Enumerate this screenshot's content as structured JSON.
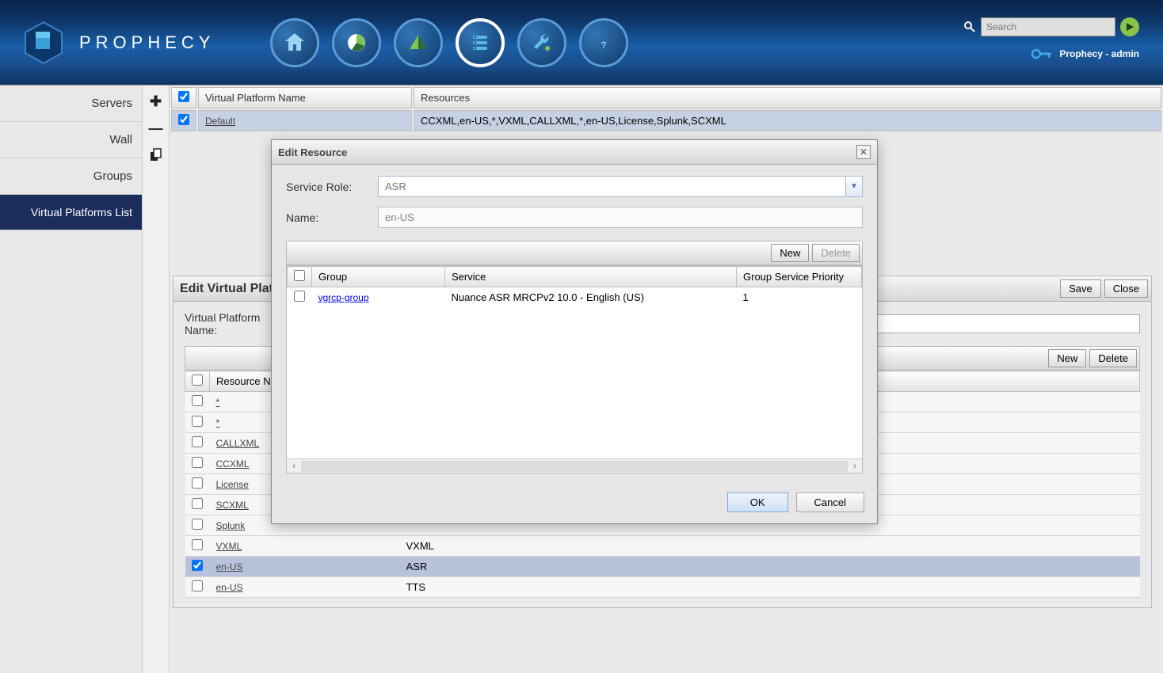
{
  "header": {
    "brand": "PROPHECY",
    "search_placeholder": "Search",
    "user_label": "Prophecy - admin"
  },
  "sidebar": {
    "items": [
      "Servers",
      "Wall",
      "Groups",
      "Virtual Platforms List"
    ]
  },
  "top_table": {
    "headers": [
      "Virtual Platform Name",
      "Resources"
    ],
    "row": {
      "name": "Default",
      "resources": "CCXML,en-US,*,VXML,CALLXML,*,en-US,License,Splunk,SCXML"
    }
  },
  "evp": {
    "title": "Edit Virtual Platform",
    "save": "Save",
    "close": "Close",
    "vp_name_label": "Virtual Platform Name:",
    "toolbar_new": "New",
    "toolbar_delete": "Delete",
    "col_resource": "Resource Name",
    "rows": [
      {
        "name": "*",
        "role": ""
      },
      {
        "name": "*",
        "role": ""
      },
      {
        "name": "CALLXML",
        "role": ""
      },
      {
        "name": "CCXML",
        "role": ""
      },
      {
        "name": "License",
        "role": ""
      },
      {
        "name": "SCXML",
        "role": ""
      },
      {
        "name": "Splunk",
        "role": ""
      },
      {
        "name": "VXML",
        "role": "VXML"
      },
      {
        "name": "en-US",
        "role": "ASR",
        "selected": true
      },
      {
        "name": "en-US",
        "role": "TTS"
      }
    ]
  },
  "modal": {
    "title": "Edit Resource",
    "service_role_label": "Service Role:",
    "service_role_value": "ASR",
    "name_label": "Name:",
    "name_value": "en-US",
    "new": "New",
    "delete": "Delete",
    "cols": {
      "group": "Group",
      "service": "Service",
      "priority": "Group Service Priority"
    },
    "row": {
      "group": "vgrcp-group",
      "service": "Nuance ASR MRCPv2 10.0 - English (US)",
      "priority": "1"
    },
    "ok": "OK",
    "cancel": "Cancel"
  }
}
